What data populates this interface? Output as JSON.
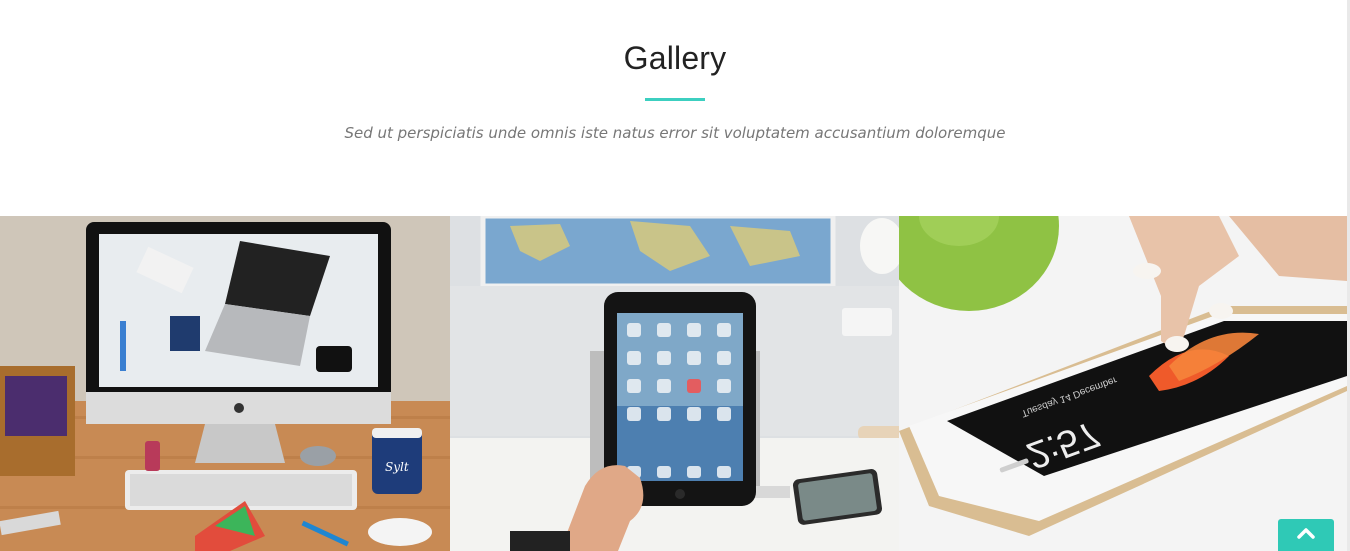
{
  "section": {
    "title": "Gallery",
    "subtitle": "Sed ut perspiciatis unde omnis iste natus error sit voluptatem accusantium doloremque",
    "accent_color": "#3ccfc0"
  },
  "gallery": {
    "items": [
      {
        "name": "imac-workspace-image",
        "icon": "imac-desk-photo"
      },
      {
        "name": "tablet-in-hand-image",
        "icon": "ipad-photo"
      },
      {
        "name": "smartphone-touch-image",
        "icon": "iphone-photo"
      }
    ]
  },
  "phone_screen": {
    "time": "2:57",
    "date": "Tuesday 14 December"
  },
  "mug_label": "Sylt",
  "scroll_top": {
    "icon": "chevron-up-icon",
    "color": "#2fc9b6"
  }
}
